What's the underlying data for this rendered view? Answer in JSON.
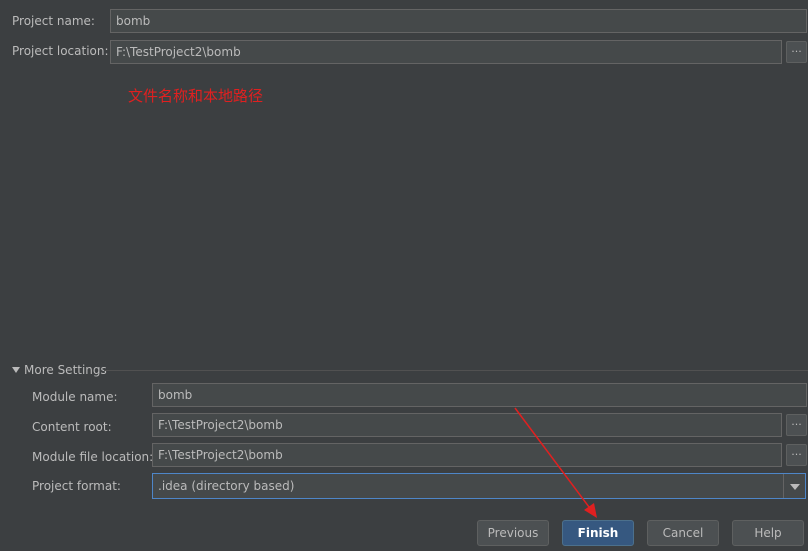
{
  "project": {
    "name_label": "Project name:",
    "name_value": "bomb",
    "location_label": "Project location:",
    "location_value": "F:\\TestProject2\\bomb",
    "browse_label": "..."
  },
  "annotation": {
    "text": "文件名称和本地路径",
    "color": "#e02020"
  },
  "more_settings": {
    "label": "More Settings",
    "module_name_label": "Module name:",
    "module_name_value": "bomb",
    "content_root_label": "Content root:",
    "content_root_value": "F:\\TestProject2\\bomb",
    "module_file_label": "Module file location:",
    "module_file_value": "F:\\TestProject2\\bomb",
    "project_format_label": "Project format:",
    "project_format_value": ".idea (directory based)",
    "browse_label": "..."
  },
  "buttons": {
    "previous": "Previous",
    "finish": "Finish",
    "cancel": "Cancel",
    "help": "Help"
  }
}
